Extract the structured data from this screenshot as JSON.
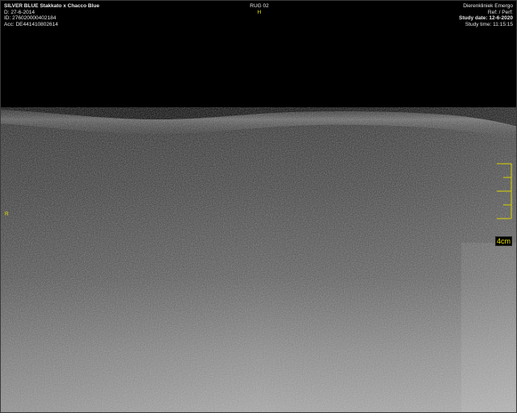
{
  "patient": {
    "name": "SILVER BLUE",
    "pedigree": "Stakkato x Chacco Blue",
    "dob": "27-6-2014",
    "id": "276020000402184",
    "acc": "DE441410802614"
  },
  "series": {
    "label": "RUG 02",
    "orientation_top": "H"
  },
  "institution": {
    "name": "Dierenkliniek Emergo",
    "ref": "Ref: / Perf:",
    "study_date": "Study date: 12-6-2020",
    "study_time": "Study time: 11:15:15"
  },
  "orientation_left": "R",
  "scale": {
    "label": "4cm"
  },
  "icons": {
    "ruler": "scale-ruler-icon"
  },
  "colors": {
    "overlay_text": "#e8e8e8",
    "marker": "#e6e200",
    "background": "#000000"
  }
}
